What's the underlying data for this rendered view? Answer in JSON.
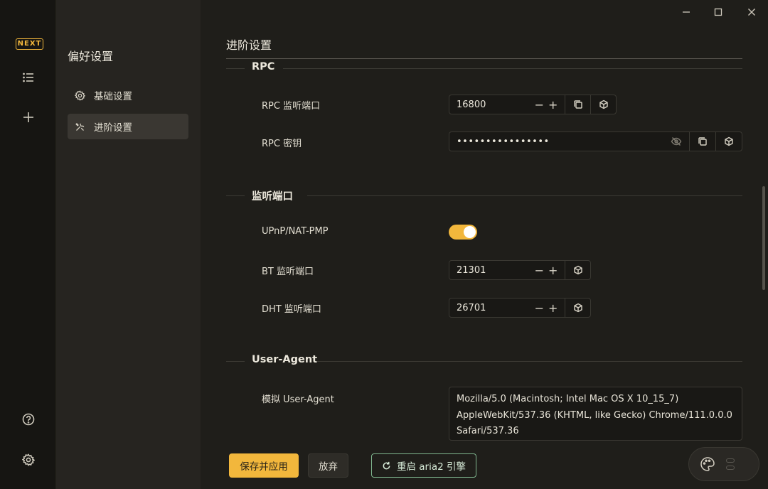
{
  "rail": {
    "logo": "NEXT",
    "icons": [
      "list-icon",
      "plus-icon",
      "help-icon",
      "gear-icon"
    ]
  },
  "subnav": {
    "title": "偏好设置",
    "items": [
      {
        "label": "基础设置",
        "icon": "gear-icon",
        "active": false
      },
      {
        "label": "进阶设置",
        "icon": "tools-icon",
        "active": true
      }
    ]
  },
  "main": {
    "title": "进阶设置",
    "sections": {
      "rpc": {
        "title": "RPC",
        "port_label": "RPC 监听端口",
        "port_value": "16800",
        "secret_label": "RPC 密钥",
        "secret_value": "••••••••••••••••"
      },
      "listen": {
        "title": "监听端口",
        "upnp_label": "UPnP/NAT-PMP",
        "upnp_on": true,
        "bt_label": "BT 监听端口",
        "bt_value": "21301",
        "dht_label": "DHT 监听端口",
        "dht_value": "26701"
      },
      "ua": {
        "title": "User-Agent",
        "label": "模拟 User-Agent",
        "value": "Mozilla/5.0 (Macintosh; Intel Mac OS X 10_15_7) AppleWebKit/537.36 (KHTML, like Gecko) Chrome/111.0.0.0 Safari/537.36"
      }
    },
    "actions": {
      "save": "保存并应用",
      "discard": "放弃",
      "restart": "重启 aria2 引擎"
    }
  },
  "colors": {
    "accent": "#f2b73c",
    "restart_border": "#7fb58e"
  }
}
